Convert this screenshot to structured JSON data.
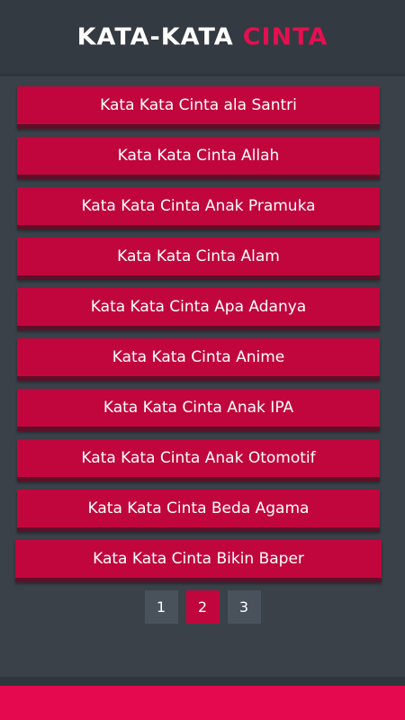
{
  "header": {
    "logo_part1": "KATA-KATA",
    "logo_part2": "CINTA"
  },
  "list": {
    "items": [
      {
        "label": "Kata Kata Cinta ala Santri"
      },
      {
        "label": "Kata Kata Cinta Allah"
      },
      {
        "label": "Kata Kata Cinta Anak Pramuka"
      },
      {
        "label": "Kata Kata Cinta Alam"
      },
      {
        "label": "Kata Kata Cinta Apa Adanya"
      },
      {
        "label": "Kata Kata Cinta Anime"
      },
      {
        "label": "Kata Kata Cinta Anak IPA"
      },
      {
        "label": "Kata Kata Cinta Anak Otomotif"
      },
      {
        "label": "Kata Kata Cinta Beda Agama"
      },
      {
        "label": "Kata Kata Cinta Bikin Baper"
      }
    ]
  },
  "pagination": {
    "pages": [
      "1",
      "2",
      "3"
    ],
    "current": "2"
  },
  "colors": {
    "accent": "#c1063d",
    "logo_accent": "#e3104f",
    "background": "#3a4149",
    "footer": "#e5094f"
  }
}
